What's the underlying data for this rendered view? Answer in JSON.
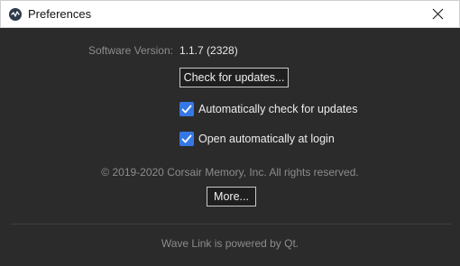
{
  "window": {
    "title": "Preferences",
    "app_icon": "wave-link-icon",
    "close_icon": "close-icon"
  },
  "version": {
    "label": "Software Version:",
    "value": "1.1.7 (2328)"
  },
  "buttons": {
    "check_updates": "Check for updates...",
    "more": "More..."
  },
  "options": [
    {
      "label": "Automatically check for updates",
      "checked": true
    },
    {
      "label": "Open automatically at login",
      "checked": true
    }
  ],
  "copyright": "© 2019-2020 Corsair Memory, Inc. All rights reserved.",
  "footer": "Wave Link is powered by Qt.",
  "colors": {
    "background": "#2b2b2b",
    "checkbox_accent": "#3578e5",
    "muted_text": "#8c8c8c"
  }
}
